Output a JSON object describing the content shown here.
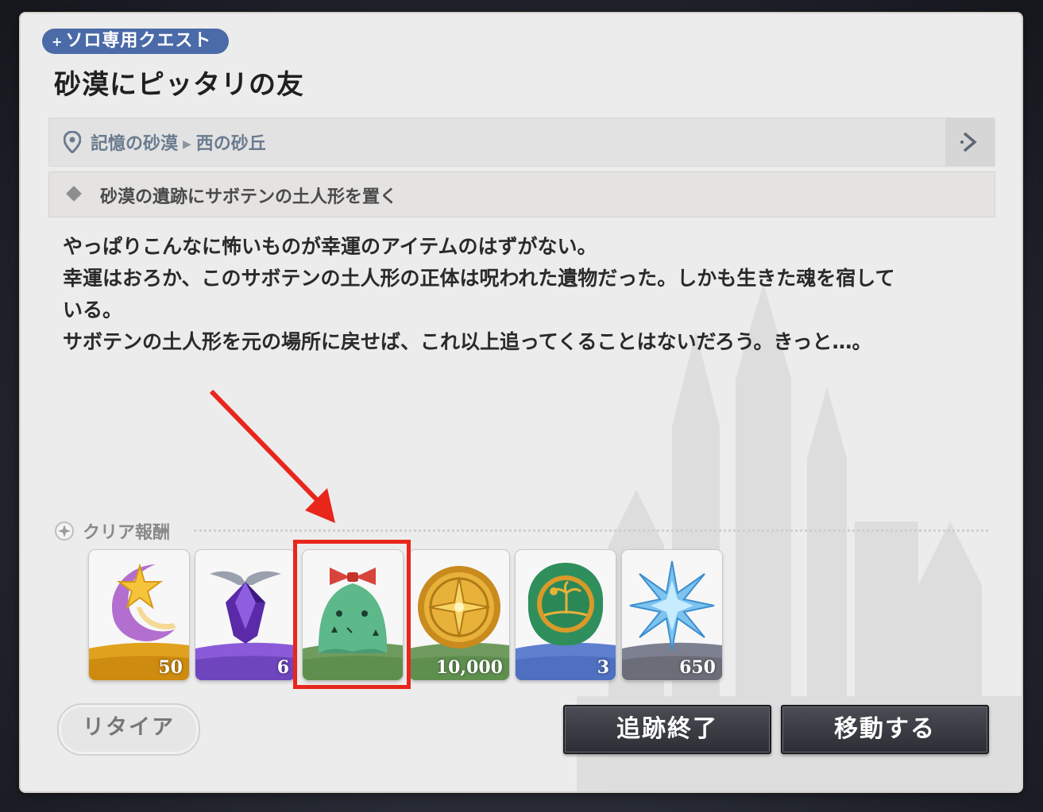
{
  "quest": {
    "badge": "ソロ専用クエスト",
    "title": "砂漠にピッタリの友"
  },
  "location": {
    "region": "記憶の砂漠",
    "area": "西の砂丘",
    "icon": "map-pin-icon",
    "go_icon": "chevron-right-icon"
  },
  "objective": {
    "text": "砂漠の遺跡にサボテンの土人形を置く"
  },
  "description": {
    "line1": "やっぱりこんなに怖いものが幸運のアイテムのはずがない。",
    "line2": "幸運はおろか、このサボテンの土人形の正体は呪われた遺物だった。しかも生きた魂を宿して",
    "line3": "いる。",
    "line4": "サボテンの土人形を元の場所に戻せば、これ以上追ってくることはないだろう。きっと…。"
  },
  "rewards": {
    "label": "クリア報酬",
    "items": [
      {
        "icon": "moon-star-icon",
        "qty": "50",
        "tier_color": "#e0a21e"
      },
      {
        "icon": "purple-crystal-icon",
        "qty": "6",
        "tier_color": "#8a5ad8"
      },
      {
        "icon": "cactus-doll-icon",
        "qty": "",
        "tier_color": "#5f8f4f"
      },
      {
        "icon": "gold-coin-icon",
        "qty": "10,000",
        "tier_color": "#5f8f4f"
      },
      {
        "icon": "palm-seal-icon",
        "qty": "3",
        "tier_color": "#4f6fc0"
      },
      {
        "icon": "blue-star-crystal-icon",
        "qty": "650",
        "tier_color": "#6b6e78"
      }
    ]
  },
  "buttons": {
    "retire": "リタイア",
    "stop_tracking": "追跡終了",
    "move": "移動する"
  },
  "colors": {
    "badge_bg": "#4b6aa8",
    "highlight": "#e8261c",
    "arrow": "#e8261c"
  }
}
